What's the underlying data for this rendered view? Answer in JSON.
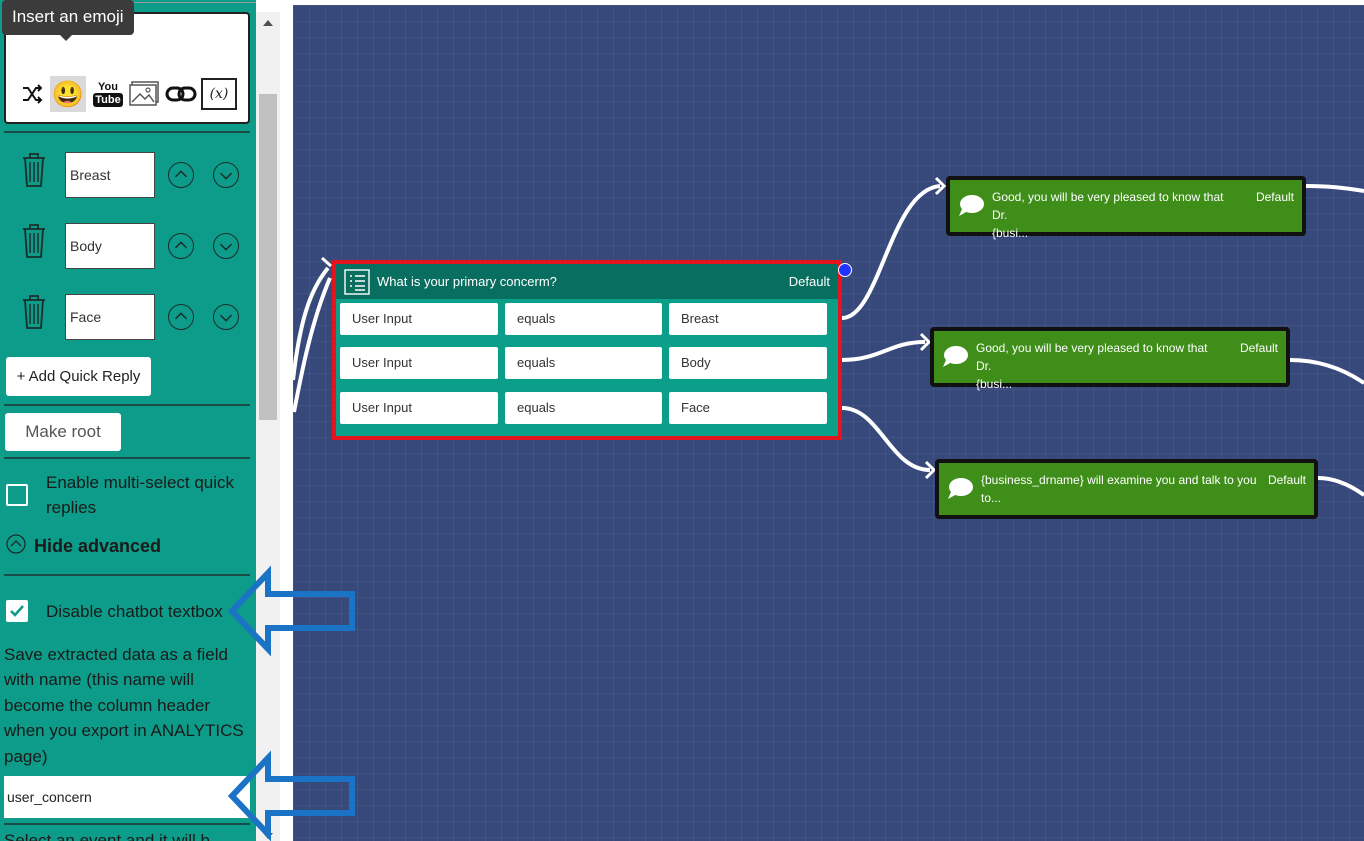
{
  "toolbar": {
    "tooltip": "Insert an emoji",
    "icons": [
      "shuffle-icon",
      "emoji-icon",
      "youtube-icon",
      "image-icon",
      "link-icon",
      "variable-icon"
    ],
    "youtube_top": "You",
    "youtube_bottom": "Tube",
    "variable_label": "(x)",
    "emoji_glyph": "😃"
  },
  "quick_replies": [
    {
      "value": "Breast"
    },
    {
      "value": "Body"
    },
    {
      "value": "Face"
    }
  ],
  "buttons": {
    "add_quick_reply": "+ Add Quick Reply",
    "make_root": "Make root",
    "hide_advanced": "Hide advanced"
  },
  "options": {
    "multi_select_label": "Enable multi-select quick replies",
    "multi_select_checked": false,
    "disable_textbox_label": "Disable chatbot textbox",
    "disable_textbox_checked": true
  },
  "save_field": {
    "description": "Save extracted data as a field with name (this name will become the column header when you export in ANALYTICS page)",
    "value": "user_concern",
    "next_text_cut": "Select an event and it will b"
  },
  "question_node": {
    "title": "What is your primary concerm?",
    "default_label": "Default",
    "rows": [
      {
        "field": "User Input",
        "operator": "equals",
        "value": "Breast"
      },
      {
        "field": "User Input",
        "operator": "equals",
        "value": "Body"
      },
      {
        "field": "User Input",
        "operator": "equals",
        "value": "Face"
      }
    ]
  },
  "message_nodes": [
    {
      "line1": "Good, you will be very pleased to know that Dr.",
      "line2": "{busi...",
      "default_label": "Default"
    },
    {
      "line1": "Good, you will be very pleased to know that Dr.",
      "line2": "{busi...",
      "default_label": "Default"
    },
    {
      "line1": "{business_drname} will examine you and talk to you",
      "line2": "to...",
      "default_label": "Default"
    }
  ],
  "colors": {
    "sidebar": "#0d9c89",
    "canvas": "#37487a",
    "node_header": "#086e5f",
    "selected_border": "#e3141e",
    "message_node": "#3f8e1a",
    "annotation_arrow": "#1a73c4"
  }
}
